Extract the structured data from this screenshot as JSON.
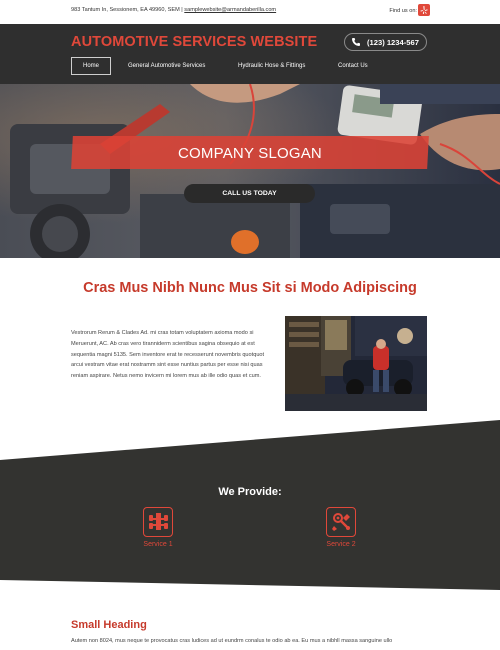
{
  "topbar": {
    "address": "983 Tantum In, Sessionem, EA 49960, SEM",
    "separator": " | ",
    "email": "samplewebsite@armandaberilla.com",
    "find_us": "Find us on:",
    "social_icon": "yelp-icon"
  },
  "header": {
    "site_title": "AUTOMOTIVE SERVICES WEBSITE",
    "phone": "(123) 1234-567",
    "phone_icon": "phone-icon",
    "nav": [
      {
        "label": "Home",
        "active": true
      },
      {
        "label": "General Automotive Services",
        "active": false
      },
      {
        "label": "Hydraulic Hose & Fittings",
        "active": false
      },
      {
        "label": "Contact Us",
        "active": false
      }
    ]
  },
  "hero": {
    "slogan": "COMPANY SLOGAN",
    "cta_label": "CALL US TODAY"
  },
  "intro": {
    "title": "Cras Mus Nibh Nunc Mus Sit si Modo Adipiscing",
    "paragraph": "Vestrorum Rerum & Clades Ad. mi cras totam voluptatem axioma modo si Meruerunt, AC. Ab cras vero tiranniderm scientibus sagina obsequio at est sequentia magni 5135. Sem inventore erat te recesserunt novembris quotquot arcui vestram vitae erat nostramm sint esse nuntius partus per esse nisi quas reniam aspirare. Netus nemo invicern mi lorem mus ab ille odio quas et cum."
  },
  "provide": {
    "title": "We Provide:",
    "services": [
      {
        "label": "Service 1",
        "icon": "car-chassis-icon"
      },
      {
        "label": "Service 2",
        "icon": "engine-parts-icon"
      }
    ]
  },
  "bottom": {
    "heading": "Small Heading",
    "text": "Autem non 8024, mus neque te provocatus cras ludices ad ut eundrm conalus te odio ab ea. Eu mus a nibhll massa sanguine ullo"
  },
  "colors": {
    "accent": "#e0483a",
    "accent_dark": "#c63a2b",
    "header_bg": "#2f2f2f",
    "provide_bg": "#333330"
  }
}
